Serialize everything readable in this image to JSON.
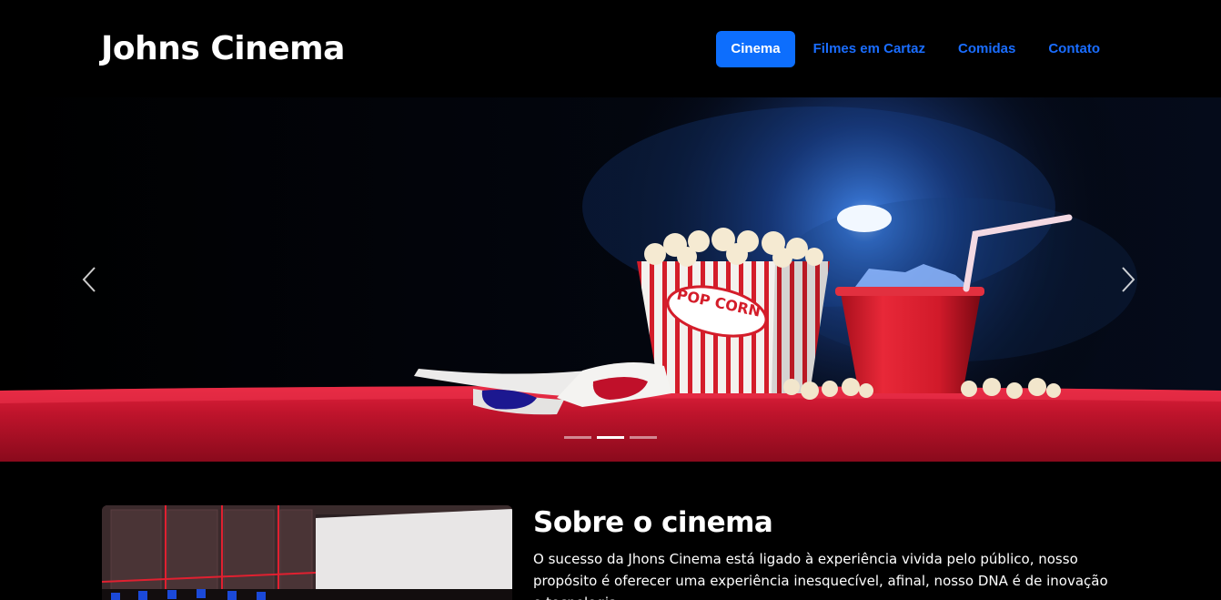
{
  "header": {
    "brand": "Johns Cinema",
    "nav": [
      {
        "label": "Cinema",
        "active": true
      },
      {
        "label": "Filmes em Cartaz",
        "active": false
      },
      {
        "label": "Comidas",
        "active": false
      },
      {
        "label": "Contato",
        "active": false
      }
    ]
  },
  "carousel": {
    "prev_icon": "chevron-left-icon",
    "next_icon": "chevron-right-icon",
    "slide_image": "popcorn-3d-glasses-drink-photo",
    "popcorn_box_text": "POP CORN",
    "slide_count": 3,
    "active_slide": 2
  },
  "about": {
    "title": "Sobre o cinema",
    "text": "O sucesso da Jhons Cinema está ligado à experiência vivida pelo público, nosso propósito é oferecer uma experiência inesquecível, afinal, nosso DNA é de inovação e tecnologia.",
    "image": "cinema-theater-screen-photo"
  },
  "colors": {
    "background": "#000000",
    "accent": "#0d6efd",
    "nav_link": "#1a6dff",
    "text": "#ffffff"
  }
}
